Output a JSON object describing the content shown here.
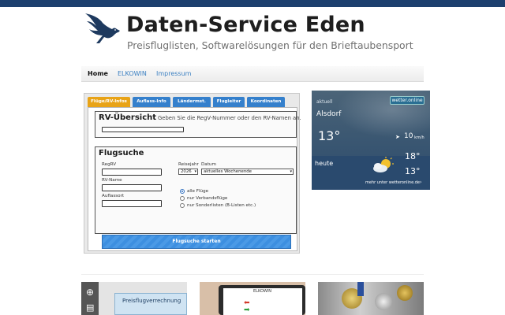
{
  "site": {
    "title": "Daten-Service Eden",
    "subtitle": "Preisfluglisten, Softwarelösungen für den Brieftaubensport"
  },
  "nav": {
    "items": [
      "Home",
      "ELKOWIN",
      "Impressum"
    ],
    "active": "Home"
  },
  "tabs": [
    "Flüge/RV-Infos",
    "Auflass-Info",
    "Ländermst.",
    "Flugleiter",
    "Koordinaten"
  ],
  "rv": {
    "title": "RV-Übersicht",
    "hint": "Geben Sie die RegV-Nummer oder den RV-Namen an.",
    "input_value": ""
  },
  "flugsuche": {
    "title": "Flugsuche",
    "regrv_label": "RegRV",
    "rvname_label": "RV-Name",
    "auflassort_label": "Auflassort",
    "reisejahr_label": "Reisejahr",
    "reisejahr_value": "2026",
    "datum_label": "Datum",
    "datum_value": "aktuelles Wochenende",
    "radios": [
      "alle Flüge",
      "nur Verbandsflüge",
      "nur Sonderlisten (B-Listen etc.)"
    ],
    "radio_selected": 0,
    "start_button": "Flugsuche starten"
  },
  "weather": {
    "now_label": "aktuell",
    "brand": "wetter.online",
    "city": "Alsdorf",
    "temp_now": "13°",
    "wind": "10",
    "wind_unit": "km/h",
    "today_label": "heute",
    "temp_high": "18°",
    "temp_low": "13°",
    "more_link": "mehr unter wetteronline.de"
  },
  "cards": [
    {
      "caption": "Preisflugverrechnung"
    },
    {
      "caption": "ELKOWIN"
    },
    {
      "caption": ""
    }
  ],
  "colors": {
    "accent": "#3580cc",
    "active_tab": "#e8a317",
    "topbar": "#1d3f6e"
  }
}
